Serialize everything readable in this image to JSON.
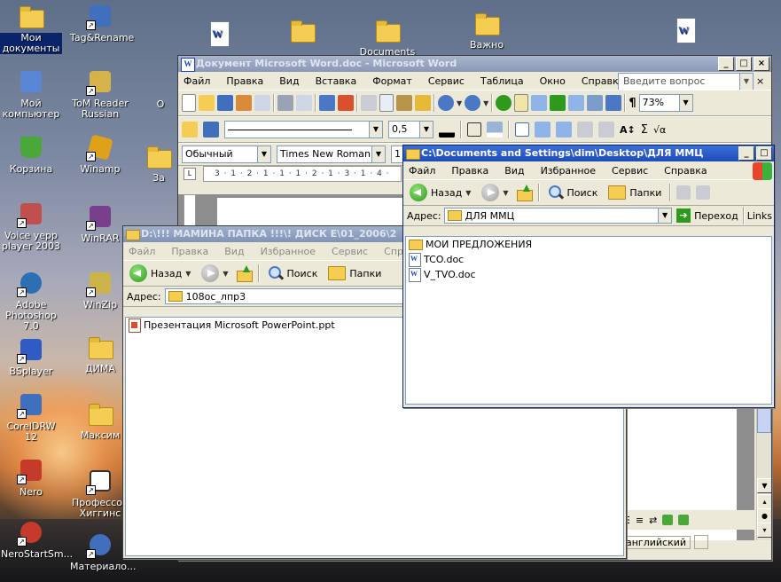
{
  "desktop": {
    "icons": [
      {
        "id": "mydocs",
        "label": "Мои документы",
        "icon": "my-documents-icon",
        "color": "#f4cd52"
      },
      {
        "id": "mycomp",
        "label": "Мой компьютер",
        "icon": "my-computer-icon",
        "color": "#5a86d6"
      },
      {
        "id": "trash",
        "label": "Корзина",
        "icon": "recycle-bin-icon",
        "color": "#4aa83a"
      },
      {
        "id": "voice",
        "label": "Voice yepp player 2003",
        "icon": "voice-player-icon",
        "color": "#c0504d"
      },
      {
        "id": "photoshop",
        "label": "Adobe Photoshop 7.0",
        "icon": "photoshop-icon",
        "color": "#2c6fb3"
      },
      {
        "id": "bsplayer",
        "label": "BSplayer",
        "icon": "bsplayer-icon",
        "color": "#2f5cc4"
      },
      {
        "id": "corel",
        "label": "CorelDRW 12",
        "icon": "coreldraw-icon",
        "color": "#3f6fbd"
      },
      {
        "id": "nero",
        "label": "Nero",
        "icon": "nero-icon",
        "color": "#c63a2c"
      },
      {
        "id": "nerostart",
        "label": "NeroStartSm...",
        "icon": "nero-start-icon",
        "color": "#c63a2c"
      },
      {
        "id": "tagrename",
        "label": "Tag&Rename",
        "icon": "tag-rename-icon",
        "color": "#3f6fbd"
      },
      {
        "id": "tomreader",
        "label": "ToM Reader Russian",
        "icon": "tom-reader-icon",
        "color": "#d6b24a"
      },
      {
        "id": "winamp",
        "label": "Winamp",
        "icon": "winamp-icon",
        "color": "#e0a11a"
      },
      {
        "id": "winrar",
        "label": "WinRAR",
        "icon": "winrar-icon",
        "color": "#7a3f8c"
      },
      {
        "id": "winzip",
        "label": "WinZip",
        "icon": "winzip-icon",
        "color": "#cdb44a"
      },
      {
        "id": "dima",
        "label": "ДИМА",
        "icon": "folder-icon",
        "color": "#f4cd52"
      },
      {
        "id": "maksim",
        "label": "Максим",
        "icon": "folder-icon",
        "color": "#f4cd52"
      },
      {
        "id": "higgins",
        "label": "Профессор Хиггинс",
        "icon": "higgins-icon",
        "color": "#d9d9d9"
      },
      {
        "id": "materials",
        "label": "Материало...",
        "icon": "materials-icon",
        "color": "#3f6fbd"
      },
      {
        "id": "documents",
        "label": "Documents",
        "icon": "folder-icon",
        "color": "#f4cd52"
      },
      {
        "id": "vazhno",
        "label": "Важно",
        "icon": "folder-icon",
        "color": "#f4cd52"
      },
      {
        "id": "partial_o",
        "label": "О",
        "icon": "folder-icon",
        "color": "#f4cd52"
      },
      {
        "id": "partial_za",
        "label": "За",
        "icon": "folder-icon",
        "color": "#f4cd52"
      }
    ]
  },
  "word": {
    "title": "Документ Microsoft Word.doc - Microsoft Word",
    "menu": [
      "Файл",
      "Правка",
      "Вид",
      "Вставка",
      "Формат",
      "Сервис",
      "Таблица",
      "Окно",
      "Справка"
    ],
    "help_placeholder": "Введите вопрос",
    "zoom": "73%",
    "line_width": "0,5",
    "style": "Обычный",
    "font": "Times New Roman",
    "font_size": "1",
    "ruler": "3 · 1 · 2 · 1 · 1 · 1 · 2 · 1 · 3 · 1 · 4 ·",
    "language": "английский"
  },
  "explorer_front": {
    "title": "C:\\Documents and Settings\\dim\\Desktop\\ДЛЯ ММЦ",
    "menu": [
      "Файл",
      "Правка",
      "Вид",
      "Избранное",
      "Сервис",
      "Справка"
    ],
    "back": "Назад",
    "search": "Поиск",
    "folders": "Папки",
    "address_label": "Адрес:",
    "address": "ДЛЯ ММЦ",
    "go": "Переход",
    "links": "Links",
    "items": [
      {
        "type": "folder",
        "name": "МОИ ПРЕДЛОЖЕНИЯ"
      },
      {
        "type": "doc",
        "name": "TCO.doc"
      },
      {
        "type": "doc",
        "name": "V_TVO.doc"
      }
    ]
  },
  "explorer_back": {
    "title": "D:\\!!! МАМИНА ПАПКА !!!\\! ДИСК  E\\01_2006\\2",
    "menu": [
      "Файл",
      "Правка",
      "Вид",
      "Избранное",
      "Сервис",
      "Справк"
    ],
    "back": "Назад",
    "search": "Поиск",
    "folders": "Папки",
    "address_label": "Адрес:",
    "address": "108ос_лпр3",
    "items": [
      {
        "type": "ppt",
        "name": "Презентация Microsoft PowerPoint.ppt"
      }
    ]
  }
}
